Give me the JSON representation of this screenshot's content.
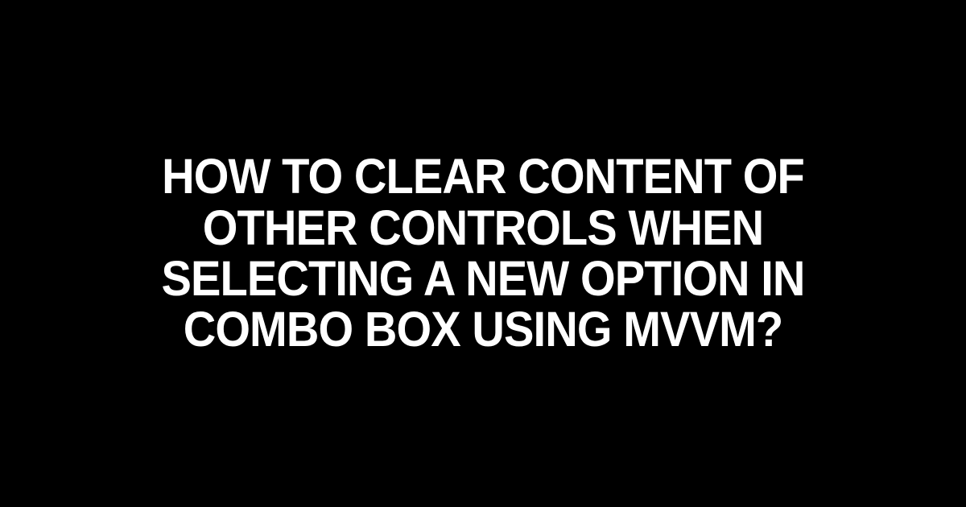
{
  "heading": "HOW TO CLEAR CONTENT OF OTHER CONTROLS WHEN SELECTING A NEW OPTION IN COMBO BOX USING MVVM?"
}
